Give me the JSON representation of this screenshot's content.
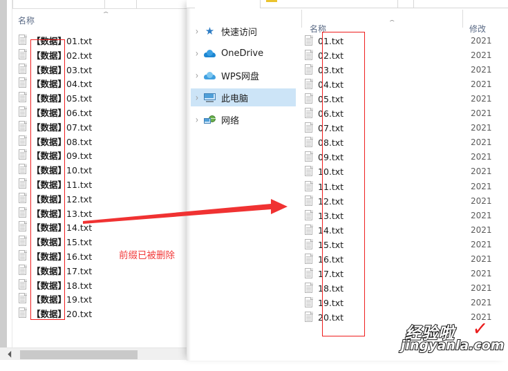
{
  "back_window": {
    "column_header": {
      "name": "名称",
      "sort_caret": "⌃"
    },
    "files": [
      {
        "prefix": "【数据】",
        "name": "01.txt"
      },
      {
        "prefix": "【数据】",
        "name": "02.txt"
      },
      {
        "prefix": "【数据】",
        "name": "03.txt"
      },
      {
        "prefix": "【数据】",
        "name": "04.txt"
      },
      {
        "prefix": "【数据】",
        "name": "05.txt"
      },
      {
        "prefix": "【数据】",
        "name": "06.txt"
      },
      {
        "prefix": "【数据】",
        "name": "07.txt"
      },
      {
        "prefix": "【数据】",
        "name": "08.txt"
      },
      {
        "prefix": "【数据】",
        "name": "09.txt"
      },
      {
        "prefix": "【数据】",
        "name": "10.txt"
      },
      {
        "prefix": "【数据】",
        "name": "11.txt"
      },
      {
        "prefix": "【数据】",
        "name": "12.txt"
      },
      {
        "prefix": "【数据】",
        "name": "13.txt"
      },
      {
        "prefix": "【数据】",
        "name": "14.txt"
      },
      {
        "prefix": "【数据】",
        "name": "15.txt"
      },
      {
        "prefix": "【数据】",
        "name": "16.txt"
      },
      {
        "prefix": "【数据】",
        "name": "17.txt"
      },
      {
        "prefix": "【数据】",
        "name": "18.txt"
      },
      {
        "prefix": "【数据】",
        "name": "19.txt"
      },
      {
        "prefix": "【数据】",
        "name": "20.txt"
      }
    ]
  },
  "front_window": {
    "nav_items": [
      {
        "label": "快速访问",
        "icon": "star-icon",
        "selected": false
      },
      {
        "label": "OneDrive",
        "icon": "cloud-icon",
        "selected": false
      },
      {
        "label": "WPS网盘",
        "icon": "cloud-icon",
        "selected": false
      },
      {
        "label": "此电脑",
        "icon": "computer-icon",
        "selected": true
      },
      {
        "label": "网络",
        "icon": "network-icon",
        "selected": false
      }
    ],
    "chevron": "›",
    "column_headers": {
      "name": "名称",
      "date_modified": "修改",
      "sort_caret": "⌃"
    },
    "files": [
      {
        "name": "01.txt",
        "date": "2021"
      },
      {
        "name": "02.txt",
        "date": "2021"
      },
      {
        "name": "03.txt",
        "date": "2021"
      },
      {
        "name": "04.txt",
        "date": "2021"
      },
      {
        "name": "05.txt",
        "date": "2021"
      },
      {
        "name": "06.txt",
        "date": "2021"
      },
      {
        "name": "07.txt",
        "date": "2021"
      },
      {
        "name": "08.txt",
        "date": "2021"
      },
      {
        "name": "09.txt",
        "date": "2021"
      },
      {
        "name": "10.txt",
        "date": "2021"
      },
      {
        "name": "11.txt",
        "date": "2021"
      },
      {
        "name": "12.txt",
        "date": "2021"
      },
      {
        "name": "13.txt",
        "date": "2021"
      },
      {
        "name": "14.txt",
        "date": "2021"
      },
      {
        "name": "15.txt",
        "date": "2021"
      },
      {
        "name": "16.txt",
        "date": "2021"
      },
      {
        "name": "17.txt",
        "date": "2021"
      },
      {
        "name": "18.txt",
        "date": "2021"
      },
      {
        "name": "19.txt",
        "date": "2021"
      },
      {
        "name": "20.txt",
        "date": "2021"
      }
    ]
  },
  "annotations": {
    "caption": "前缀已被删除",
    "arrow_color": "#f03232",
    "box_color": "#ee1c1c"
  },
  "watermark": {
    "brand": "经验啦",
    "check": "✓",
    "url": "jingyanla.com"
  }
}
